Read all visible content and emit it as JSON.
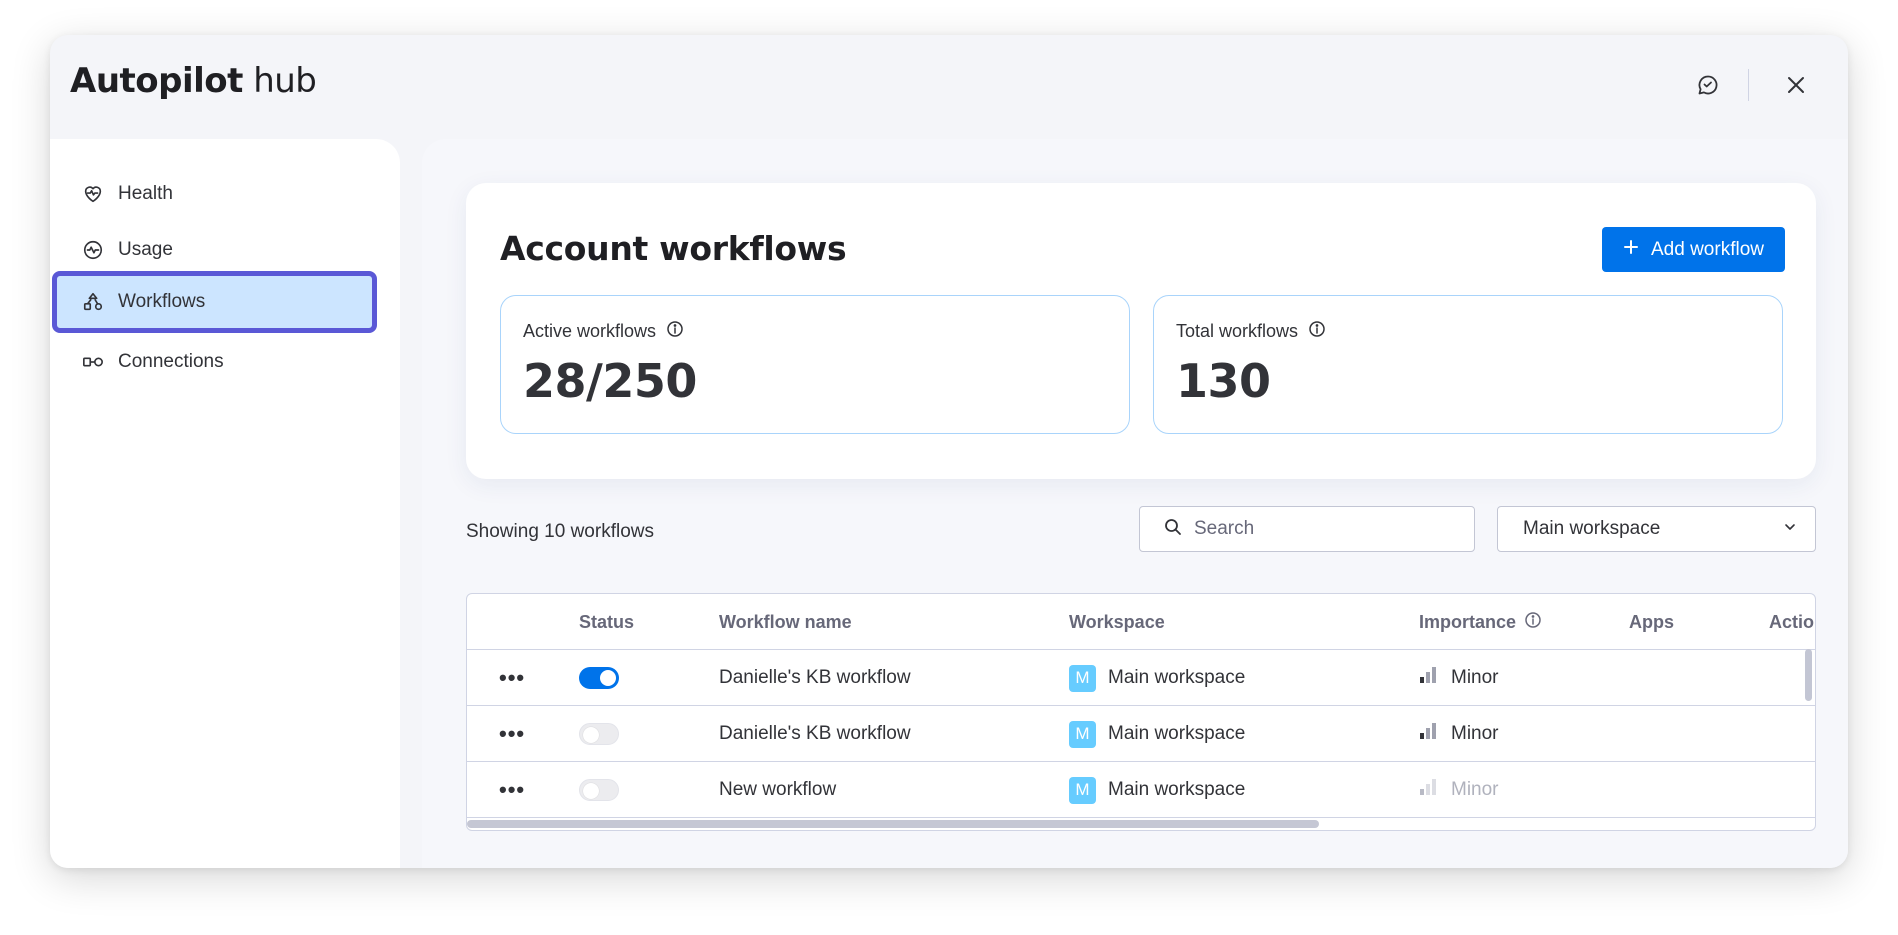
{
  "app": {
    "title_bold": "Autopilot",
    "title_light": "hub"
  },
  "header": {
    "feedback_icon": "feedback-chat-icon",
    "close_icon": "close-icon"
  },
  "sidebar": {
    "items": [
      {
        "label": "Health",
        "icon": "heart-pulse-icon",
        "active": false
      },
      {
        "label": "Usage",
        "icon": "activity-icon",
        "active": false
      },
      {
        "label": "Workflows",
        "icon": "workflows-icon",
        "active": true
      },
      {
        "label": "Connections",
        "icon": "connections-icon",
        "active": false
      }
    ]
  },
  "card": {
    "title": "Account workflows",
    "add_button_label": "Add workflow",
    "stats": [
      {
        "label": "Active workflows",
        "value": "28/250"
      },
      {
        "label": "Total workflows",
        "value": "130"
      }
    ]
  },
  "toolbar": {
    "showing_text": "Showing 10 workflows",
    "search_placeholder": "Search",
    "workspace_selected": "Main workspace"
  },
  "table": {
    "columns": [
      "Status",
      "Workflow name",
      "Workspace",
      "Importance",
      "Apps",
      "Actio"
    ],
    "rows": [
      {
        "active": true,
        "name": "Danielle's KB workflow",
        "workspace_initial": "M",
        "workspace": "Main workspace",
        "importance": "Minor",
        "importance_muted": false
      },
      {
        "active": false,
        "name": "Danielle's KB workflow",
        "workspace_initial": "M",
        "workspace": "Main workspace",
        "importance": "Minor",
        "importance_muted": false
      },
      {
        "active": false,
        "name": "New workflow",
        "workspace_initial": "M",
        "workspace": "Main workspace",
        "importance": "Minor",
        "importance_muted": true
      }
    ]
  },
  "colors": {
    "accent": "#0073ea",
    "active_nav_bg": "#cce5ff",
    "active_nav_border": "#5a58d6",
    "workspace_badge": "#66ccff"
  }
}
